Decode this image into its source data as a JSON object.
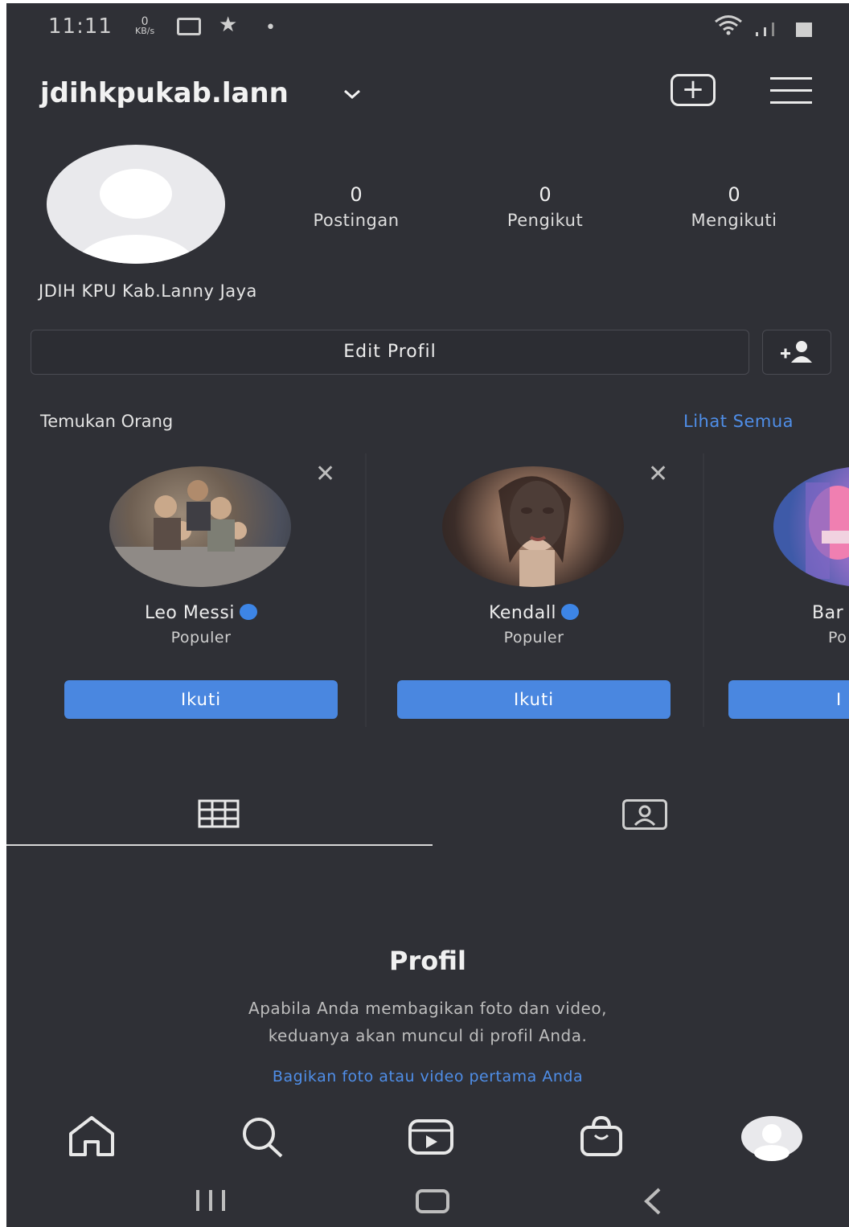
{
  "status_bar": {
    "time": "11:11",
    "kbs_value": "0",
    "kbs_unit": "KB/s",
    "icons": [
      "gallery-icon",
      "star-icon",
      "dot-icon",
      "wifi-icon",
      "signal-icon",
      "battery-icon"
    ]
  },
  "header": {
    "username": "jdihkpukab.lann",
    "icons": [
      "chevron-down-icon",
      "new-post-icon",
      "menu-icon"
    ]
  },
  "profile": {
    "stats": [
      {
        "value": "0",
        "label": "Postingan"
      },
      {
        "value": "0",
        "label": "Pengikut"
      },
      {
        "value": "0",
        "label": "Mengikuti"
      }
    ],
    "full_name": "JDIH KPU Kab.Lanny Jaya",
    "edit_label": "Edit Profil"
  },
  "discover": {
    "title": "Temukan Orang",
    "see_all": "Lihat Semua",
    "cards": [
      {
        "name": "Leo Messi",
        "subtitle": "Populer",
        "button": "Ikuti",
        "verified": true
      },
      {
        "name": "Kendall",
        "subtitle": "Populer",
        "button": "Ikuti",
        "verified": true
      },
      {
        "name": "Bar",
        "subtitle": "Po",
        "button": "I",
        "verified": false
      }
    ]
  },
  "empty_state": {
    "title": "Profil",
    "line1": "Apabila Anda membagikan foto dan video,",
    "line2": "keduanya akan muncul di profil Anda.",
    "link": "Bagikan foto atau video pertama Anda"
  },
  "colors": {
    "background": "#2f3036",
    "accent": "#4a87e0",
    "link": "#4f8ee8"
  },
  "bottom_nav": [
    "home-icon",
    "search-icon",
    "reels-icon",
    "shop-icon",
    "profile-avatar-icon"
  ],
  "system_nav": [
    "recents-icon",
    "home-button-icon",
    "back-icon"
  ]
}
